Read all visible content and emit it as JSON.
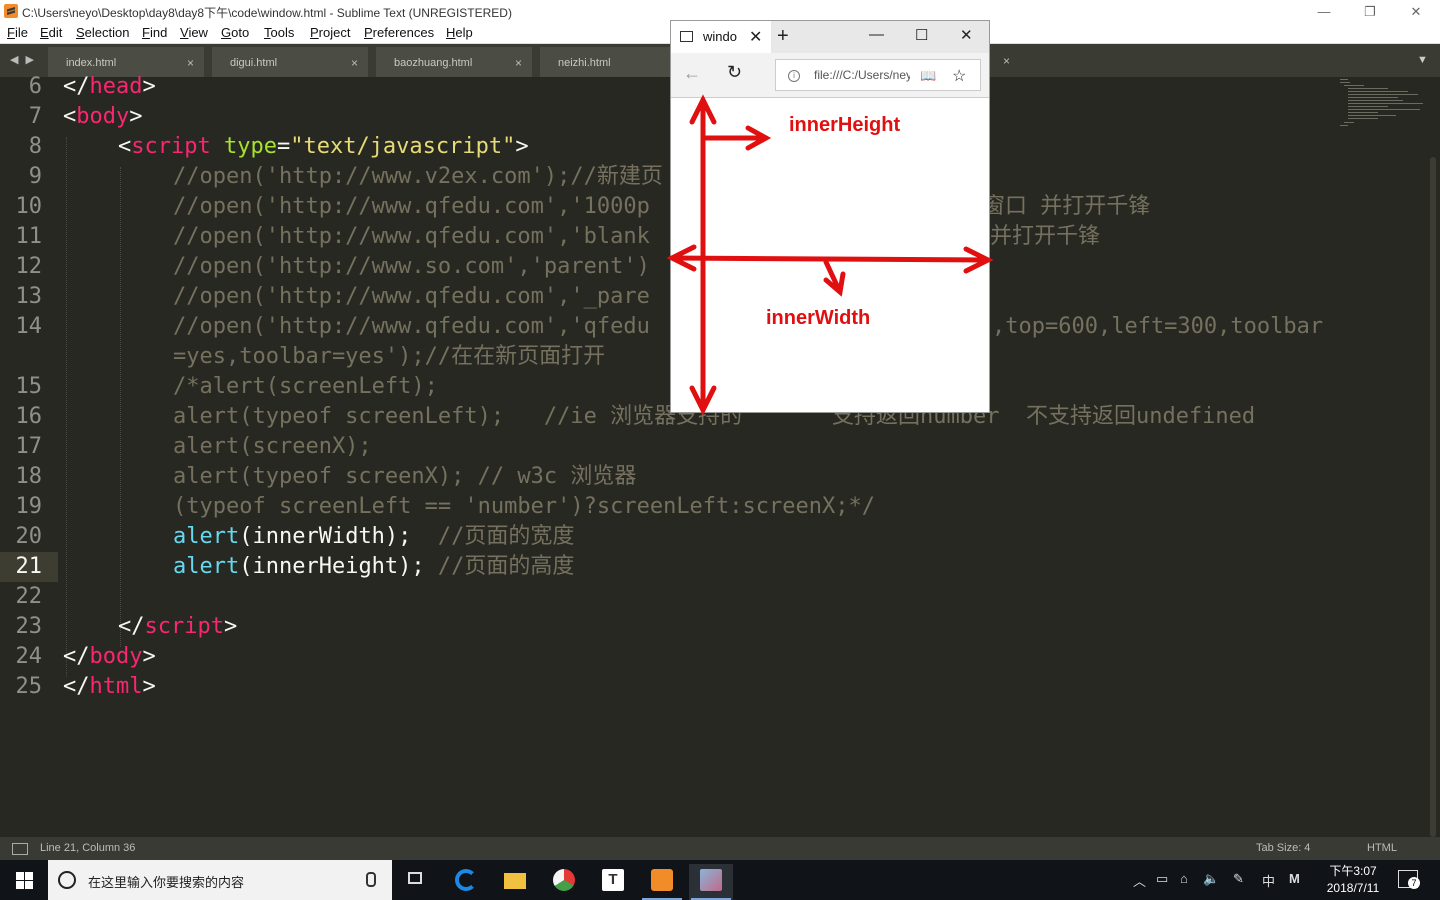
{
  "window": {
    "title": "C:\\Users\\neyo\\Desktop\\day8\\day8下午\\code\\window.html - Sublime Text (UNREGISTERED)",
    "minimize": "—",
    "maximize": "❐",
    "close": "✕"
  },
  "menu": [
    "File",
    "Edit",
    "Selection",
    "Find",
    "View",
    "Goto",
    "Tools",
    "Project",
    "Preferences",
    "Help"
  ],
  "tabs": [
    {
      "label": "index.html",
      "close": "×"
    },
    {
      "label": "digui.html",
      "close": "×"
    },
    {
      "label": "baozhuang.html",
      "close": "×"
    },
    {
      "label": "neizhi.html",
      "close": "×"
    }
  ],
  "tab_nav": "◀ ▶",
  "tab_extra_close": "×",
  "tab_dropdown": "▼",
  "editor": {
    "current_line": "21",
    "lines": [
      {
        "n": "6"
      },
      {
        "n": "7"
      },
      {
        "n": "8"
      },
      {
        "n": "9"
      },
      {
        "n": "10"
      },
      {
        "n": "11"
      },
      {
        "n": "12"
      },
      {
        "n": "13"
      },
      {
        "n": "14"
      },
      {
        "n": ""
      },
      {
        "n": "15"
      },
      {
        "n": "16"
      },
      {
        "n": "17"
      },
      {
        "n": "18"
      },
      {
        "n": "19"
      },
      {
        "n": "20"
      },
      {
        "n": "21"
      },
      {
        "n": "22"
      },
      {
        "n": "23"
      },
      {
        "n": "24"
      },
      {
        "n": "25"
      }
    ],
    "code": {
      "l6_a": "</",
      "l6_b": "head",
      "l6_c": ">",
      "l7_a": "<",
      "l7_b": "body",
      "l7_c": ">",
      "l8_a": "<",
      "l8_b": "script",
      "l8_c": " ",
      "l8_d": "type",
      "l8_e": "=",
      "l8_f": "\"text/javascript\"",
      "l8_g": ">",
      "l9": "//open('http://www.v2ex.com');//新建页",
      "l10_a": "//open('http://www.qfedu.com','1000p",
      "l10_b": "窗口 并打开千锋",
      "l11_a": "//open('http://www.qfedu.com','blank",
      "l11_b": "并打开千锋",
      "l12": "//open('http://www.so.com','parent')",
      "l13": "//open('http://www.qfedu.com','_pare",
      "l14_a": "//open('http://www.qfedu.com','qfedu",
      "l14_b": ",top=600,left=300,toolbar",
      "l14w": "=yes,toolbar=yes');//在在新页面打开",
      "l15": "/*alert(screenLeft);",
      "l16_a": "alert(typeof screenLeft);   //ie 浏览器支持的",
      "l16_b": "支持返回number  不支持返回undefined",
      "l17": "alert(screenX);",
      "l18": "alert(typeof screenX); // w3c 浏览器",
      "l19": "(typeof screenLeft == 'number')?screenLeft:screenX;*/",
      "l20_a": "alert",
      "l20_b": "(innerWidth);",
      "l20_c": "  //页面的宽度",
      "l21_a": "alert",
      "l21_b": "(innerHeight);",
      "l21_c": " //页面的高度",
      "l23_a": "</",
      "l23_b": "script",
      "l23_c": ">",
      "l24_a": "</",
      "l24_b": "body",
      "l24_c": ">",
      "l25_a": "</",
      "l25_b": "html",
      "l25_c": ">"
    }
  },
  "status": {
    "position": "Line 21, Column 36",
    "tab_size": "Tab Size: 4",
    "syntax": "HTML"
  },
  "popup": {
    "tab_title": "windo",
    "tab_close": "✕",
    "new_tab": "+",
    "minimize": "—",
    "maximize": "☐",
    "close": "✕",
    "back": "←",
    "reload": "↻",
    "info": "i",
    "url": "file:///C:/Users/neyo/Desktop",
    "reading": "📖",
    "favorite": "☆"
  },
  "annotations": {
    "inner_height": "innerHeight",
    "inner_width": "innerWidth",
    "arrow_color": "#e01010"
  },
  "taskbar": {
    "search_placeholder": "在这里输入你要搜索的内容",
    "ime": "中",
    "ime2": "M",
    "time": "下午3:07",
    "date": "2018/7/11",
    "notif_count": "7"
  }
}
